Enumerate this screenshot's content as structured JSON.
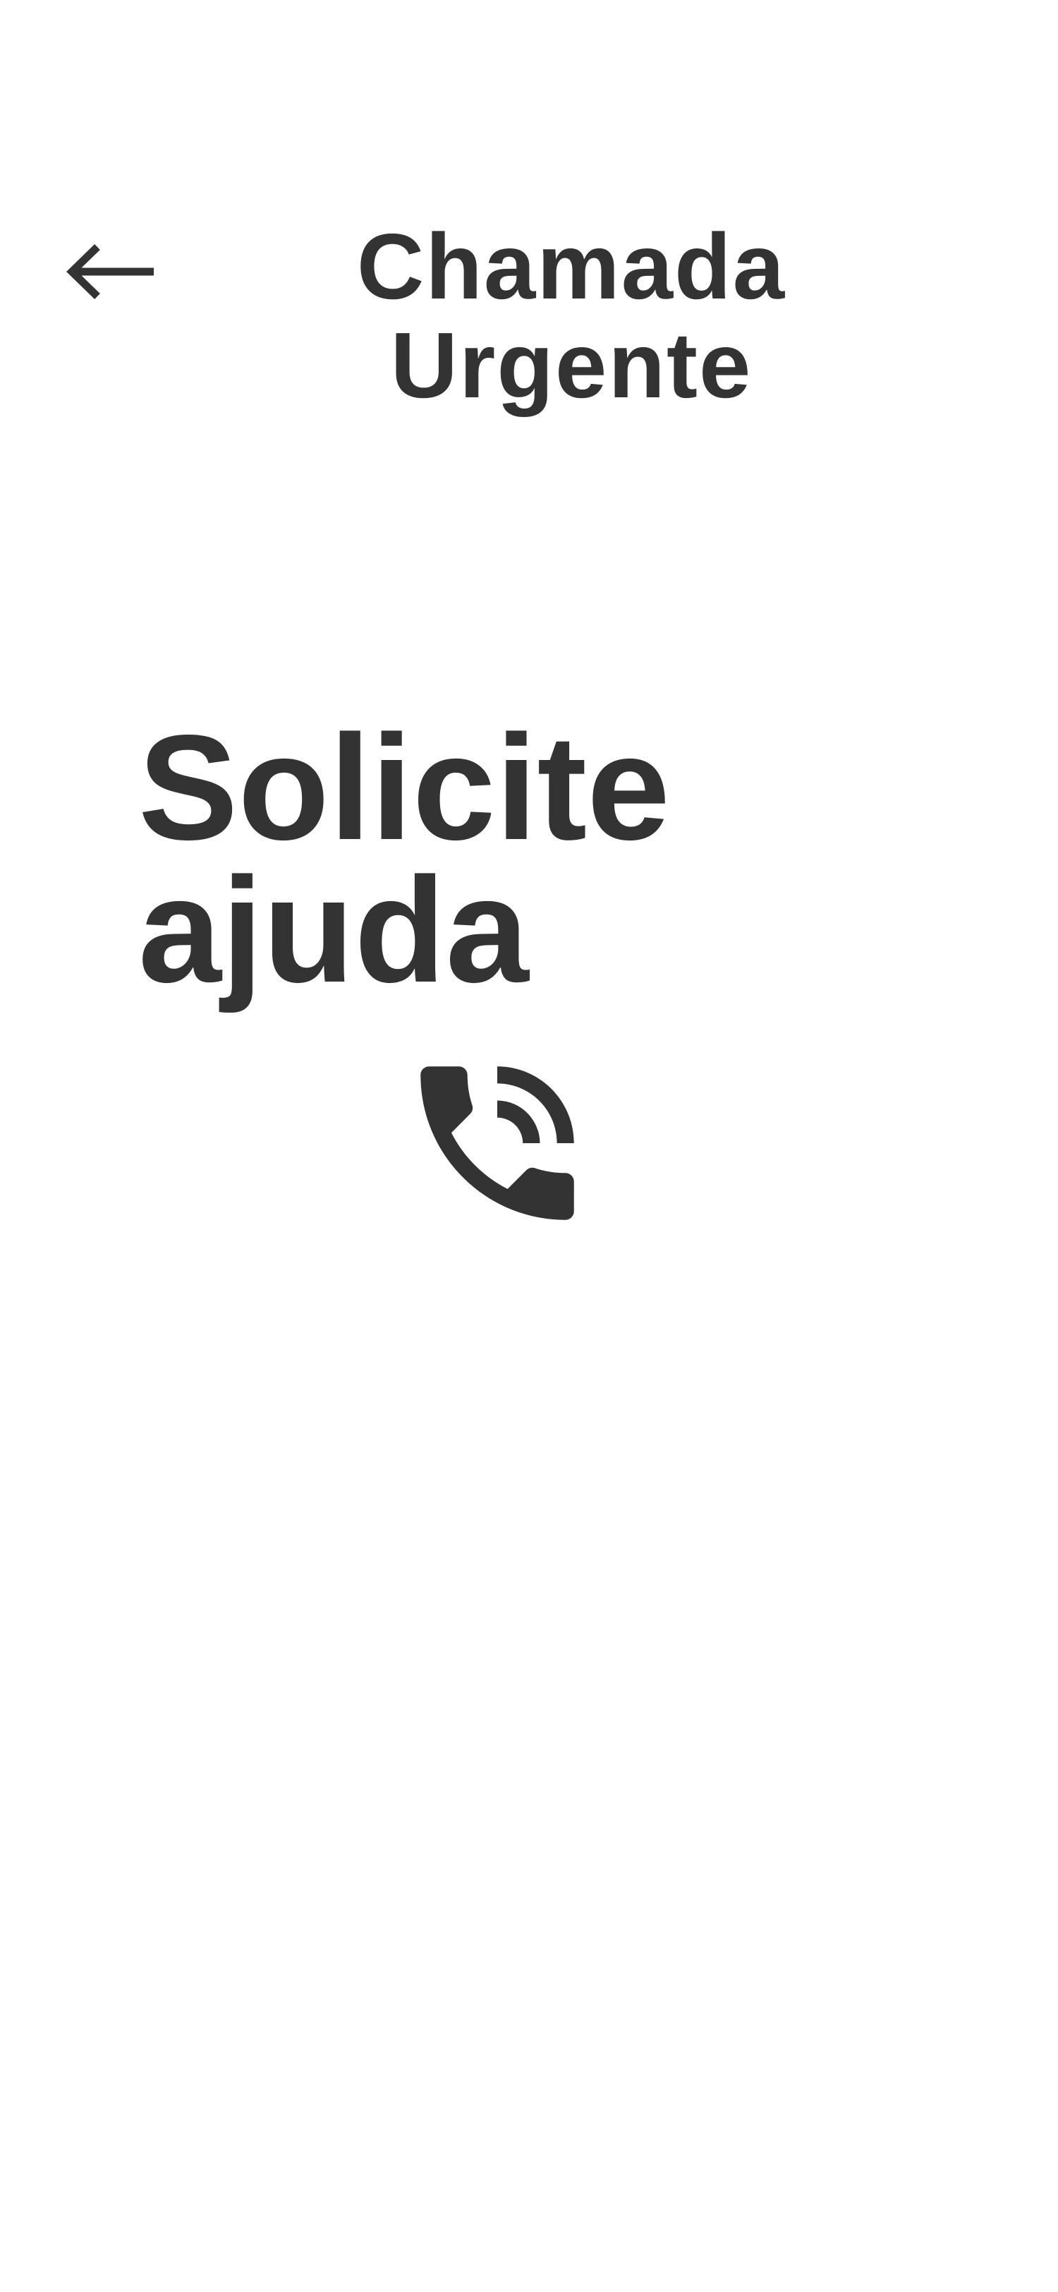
{
  "header": {
    "back_icon": "arrow-left-icon",
    "title": "Chamada Urgente"
  },
  "main": {
    "heading": "Solicite ajuda",
    "call_icon": "phone-in-talk-icon"
  },
  "colors": {
    "text": "#333333",
    "background": "#ffffff"
  }
}
